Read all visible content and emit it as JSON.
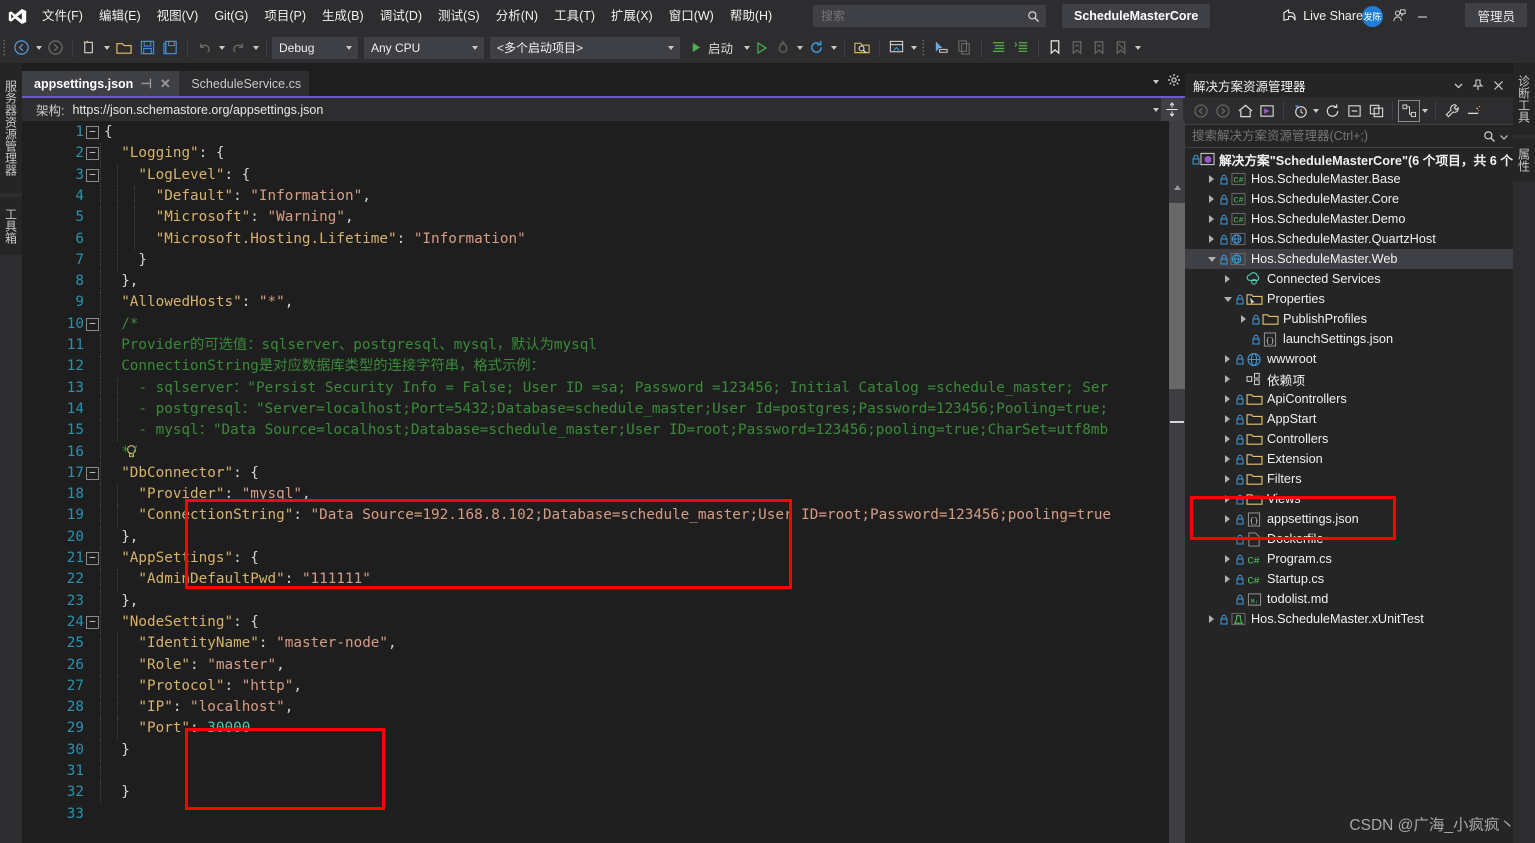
{
  "titlebar": {
    "menus": [
      "文件(F)",
      "编辑(E)",
      "视图(V)",
      "Git(G)",
      "项目(P)",
      "生成(B)",
      "调试(D)",
      "测试(S)",
      "分析(N)",
      "工具(T)",
      "扩展(X)",
      "窗口(W)",
      "帮助(H)"
    ],
    "search_placeholder": "搜索",
    "solution_name": "ScheduleMasterCore",
    "avatar_text": "发陈",
    "window_minimize": "—",
    "window_maximize": "▢",
    "window_close": "✕"
  },
  "toolbar": {
    "configuration": "Debug",
    "platform": "Any CPU",
    "startup_project": "<多个启动项目>",
    "start_label": "启动",
    "live_share_label": "Live Share",
    "admin_label": "管理员"
  },
  "left_rail": {
    "tabs": [
      "服务器资源管理器",
      "工具箱"
    ]
  },
  "right_rail": {
    "tabs": [
      "诊断工具",
      "属性"
    ]
  },
  "editor": {
    "tabs": [
      {
        "label": "appsettings.json",
        "active": true
      },
      {
        "label": "ScheduleService.cs",
        "active": false
      }
    ],
    "schema_label": "架构:",
    "schema_url": "https://json.schemastore.org/appsettings.json",
    "lines": [
      {
        "n": 1,
        "tokens": [
          {
            "t": "{",
            "c": "p"
          }
        ],
        "indent": 0,
        "fold": "minus"
      },
      {
        "n": 2,
        "tokens": [
          {
            "t": "\"Logging\"",
            "c": "k"
          },
          {
            "t": ": {",
            "c": "p"
          }
        ],
        "indent": 1,
        "fold": "minus"
      },
      {
        "n": 3,
        "tokens": [
          {
            "t": "\"LogLevel\"",
            "c": "k"
          },
          {
            "t": ": {",
            "c": "p"
          }
        ],
        "indent": 2,
        "fold": "minus"
      },
      {
        "n": 4,
        "tokens": [
          {
            "t": "\"Default\"",
            "c": "k"
          },
          {
            "t": ": ",
            "c": "p"
          },
          {
            "t": "\"Information\"",
            "c": "s"
          },
          {
            "t": ",",
            "c": "p"
          }
        ],
        "indent": 3
      },
      {
        "n": 5,
        "tokens": [
          {
            "t": "\"Microsoft\"",
            "c": "k"
          },
          {
            "t": ": ",
            "c": "p"
          },
          {
            "t": "\"Warning\"",
            "c": "s"
          },
          {
            "t": ",",
            "c": "p"
          }
        ],
        "indent": 3
      },
      {
        "n": 6,
        "tokens": [
          {
            "t": "\"Microsoft.Hosting.Lifetime\"",
            "c": "k"
          },
          {
            "t": ": ",
            "c": "p"
          },
          {
            "t": "\"Information\"",
            "c": "s"
          }
        ],
        "indent": 3
      },
      {
        "n": 7,
        "tokens": [
          {
            "t": "}",
            "c": "p"
          }
        ],
        "indent": 2
      },
      {
        "n": 8,
        "tokens": [
          {
            "t": "},",
            "c": "p"
          }
        ],
        "indent": 1
      },
      {
        "n": 9,
        "tokens": [
          {
            "t": "\"AllowedHosts\"",
            "c": "k"
          },
          {
            "t": ": ",
            "c": "p"
          },
          {
            "t": "\"*\"",
            "c": "s"
          },
          {
            "t": ",",
            "c": "p"
          }
        ],
        "indent": 1
      },
      {
        "n": 10,
        "tokens": [
          {
            "t": "/*",
            "c": "cmt"
          }
        ],
        "indent": 1,
        "fold": "minus"
      },
      {
        "n": 11,
        "tokens": [
          {
            "t": "Provider的可选值：sqlserver、postgresql、mysql，默认为mysql",
            "c": "cmt"
          }
        ],
        "indent": 1
      },
      {
        "n": 12,
        "tokens": [
          {
            "t": "ConnectionString是对应数据库类型的连接字符串，格式示例：",
            "c": "cmt"
          }
        ],
        "indent": 1
      },
      {
        "n": 13,
        "tokens": [
          {
            "t": "- sqlserver：\"Persist Security Info = False; User ID =sa; Password =123456; Initial Catalog =schedule_master; Ser",
            "c": "cmt"
          }
        ],
        "indent": 2
      },
      {
        "n": 14,
        "tokens": [
          {
            "t": "- postgresql：\"Server=localhost;Port=5432;Database=schedule_master;User Id=postgres;Password=123456;Pooling=true;",
            "c": "cmt"
          }
        ],
        "indent": 2
      },
      {
        "n": 15,
        "tokens": [
          {
            "t": "- mysql：\"Data Source=localhost;Database=schedule_master;User ID=root;Password=123456;pooling=true;CharSet=utf8mb",
            "c": "cmt"
          }
        ],
        "indent": 2
      },
      {
        "n": 16,
        "tokens": [
          {
            "t": "*/",
            "c": "cmt"
          }
        ],
        "indent": 1,
        "bulb": true
      },
      {
        "n": 17,
        "tokens": [
          {
            "t": "\"DbConnector\"",
            "c": "k"
          },
          {
            "t": ": {",
            "c": "p"
          }
        ],
        "indent": 1,
        "fold": "minus"
      },
      {
        "n": 18,
        "tokens": [
          {
            "t": "\"Provider\"",
            "c": "k"
          },
          {
            "t": ": ",
            "c": "p"
          },
          {
            "t": "\"mysql\"",
            "c": "s"
          },
          {
            "t": ",",
            "c": "p"
          }
        ],
        "indent": 2
      },
      {
        "n": 19,
        "tokens": [
          {
            "t": "\"ConnectionString\"",
            "c": "k"
          },
          {
            "t": ": ",
            "c": "p"
          },
          {
            "t": "\"Data Source=192.168.8.102;Database=schedule_master;User ID=root;Password=123456;pooling=true",
            "c": "s"
          }
        ],
        "indent": 2
      },
      {
        "n": 20,
        "tokens": [
          {
            "t": "},",
            "c": "p"
          }
        ],
        "indent": 1
      },
      {
        "n": 21,
        "tokens": [
          {
            "t": "\"AppSettings\"",
            "c": "k"
          },
          {
            "t": ": {",
            "c": "p"
          }
        ],
        "indent": 1,
        "fold": "minus"
      },
      {
        "n": 22,
        "tokens": [
          {
            "t": "\"AdminDefaultPwd\"",
            "c": "k"
          },
          {
            "t": ": ",
            "c": "p"
          },
          {
            "t": "\"111111\"",
            "c": "s"
          }
        ],
        "indent": 2
      },
      {
        "n": 23,
        "tokens": [
          {
            "t": "},",
            "c": "p"
          }
        ],
        "indent": 1
      },
      {
        "n": 24,
        "tokens": [
          {
            "t": "\"NodeSetting\"",
            "c": "k"
          },
          {
            "t": ": {",
            "c": "p"
          }
        ],
        "indent": 1,
        "fold": "minus"
      },
      {
        "n": 25,
        "tokens": [
          {
            "t": "\"IdentityName\"",
            "c": "k"
          },
          {
            "t": ": ",
            "c": "p"
          },
          {
            "t": "\"master-node\"",
            "c": "s"
          },
          {
            "t": ",",
            "c": "p"
          }
        ],
        "indent": 2
      },
      {
        "n": 26,
        "tokens": [
          {
            "t": "\"Role\"",
            "c": "k"
          },
          {
            "t": ": ",
            "c": "p"
          },
          {
            "t": "\"master\"",
            "c": "s"
          },
          {
            "t": ",",
            "c": "p"
          }
        ],
        "indent": 2
      },
      {
        "n": 27,
        "tokens": [
          {
            "t": "\"Protocol\"",
            "c": "k"
          },
          {
            "t": ": ",
            "c": "p"
          },
          {
            "t": "\"http\"",
            "c": "s"
          },
          {
            "t": ",",
            "c": "p"
          }
        ],
        "indent": 2
      },
      {
        "n": 28,
        "tokens": [
          {
            "t": "\"IP\"",
            "c": "k"
          },
          {
            "t": ": ",
            "c": "p"
          },
          {
            "t": "\"localhost\"",
            "c": "s"
          },
          {
            "t": ",",
            "c": "p"
          }
        ],
        "indent": 2
      },
      {
        "n": 29,
        "tokens": [
          {
            "t": "\"Port\"",
            "c": "k"
          },
          {
            "t": ": ",
            "c": "p"
          },
          {
            "t": "30000",
            "c": "num"
          }
        ],
        "indent": 2
      },
      {
        "n": 30,
        "tokens": [
          {
            "t": "}",
            "c": "p"
          }
        ],
        "indent": 1
      },
      {
        "n": 31,
        "tokens": [],
        "indent": 1
      },
      {
        "n": 32,
        "tokens": [
          {
            "t": "}",
            "c": "p"
          }
        ],
        "indent": 1
      },
      {
        "n": 33,
        "tokens": [],
        "indent": 0
      }
    ]
  },
  "solution_explorer": {
    "title": "解决方案资源管理器",
    "search_placeholder": "搜索解决方案资源管理器(Ctrl+;)",
    "tree": [
      {
        "depth": 0,
        "twisty": "none",
        "lock": true,
        "icon": "solution-icon",
        "label": "解决方案\"ScheduleMasterCore\"(6 个项目，共 6 个",
        "bold": true
      },
      {
        "depth": 1,
        "twisty": "closed",
        "lock": true,
        "icon": "csharp-icon",
        "label": "Hos.ScheduleMaster.Base"
      },
      {
        "depth": 1,
        "twisty": "closed",
        "lock": true,
        "icon": "csharp-icon",
        "label": "Hos.ScheduleMaster.Core"
      },
      {
        "depth": 1,
        "twisty": "closed",
        "lock": true,
        "icon": "csharp-icon",
        "label": "Hos.ScheduleMaster.Demo"
      },
      {
        "depth": 1,
        "twisty": "closed",
        "lock": true,
        "icon": "web-project-icon",
        "label": "Hos.ScheduleMaster.QuartzHost"
      },
      {
        "depth": 1,
        "twisty": "open",
        "lock": true,
        "icon": "web-project-icon",
        "label": "Hos.ScheduleMaster.Web",
        "selected": true
      },
      {
        "depth": 2,
        "twisty": "closed",
        "lock": false,
        "icon": "connected-services-icon",
        "label": "Connected Services"
      },
      {
        "depth": 2,
        "twisty": "open",
        "lock": true,
        "icon": "properties-folder-icon",
        "label": "Properties"
      },
      {
        "depth": 3,
        "twisty": "closed",
        "lock": true,
        "icon": "folder-icon",
        "label": "PublishProfiles"
      },
      {
        "depth": 3,
        "twisty": "none",
        "lock": true,
        "icon": "json-icon",
        "label": "launchSettings.json"
      },
      {
        "depth": 2,
        "twisty": "closed",
        "lock": true,
        "icon": "wwwroot-icon",
        "label": "wwwroot"
      },
      {
        "depth": 2,
        "twisty": "closed",
        "lock": false,
        "icon": "dependencies-icon",
        "label": "依赖项"
      },
      {
        "depth": 2,
        "twisty": "closed",
        "lock": true,
        "icon": "folder-icon",
        "label": "ApiControllers"
      },
      {
        "depth": 2,
        "twisty": "closed",
        "lock": true,
        "icon": "folder-icon",
        "label": "AppStart"
      },
      {
        "depth": 2,
        "twisty": "closed",
        "lock": true,
        "icon": "folder-icon",
        "label": "Controllers"
      },
      {
        "depth": 2,
        "twisty": "closed",
        "lock": true,
        "icon": "folder-icon",
        "label": "Extension"
      },
      {
        "depth": 2,
        "twisty": "closed",
        "lock": true,
        "icon": "folder-icon",
        "label": "Filters"
      },
      {
        "depth": 2,
        "twisty": "closed",
        "lock": true,
        "icon": "folder-icon",
        "label": "Views"
      },
      {
        "depth": 2,
        "twisty": "closed",
        "lock": true,
        "icon": "json-icon",
        "label": "appsettings.json"
      },
      {
        "depth": 2,
        "twisty": "none",
        "lock": true,
        "icon": "file-icon",
        "label": "Dockerfile"
      },
      {
        "depth": 2,
        "twisty": "closed",
        "lock": true,
        "icon": "csharp-file-icon",
        "label": "Program.cs"
      },
      {
        "depth": 2,
        "twisty": "closed",
        "lock": true,
        "icon": "csharp-file-icon",
        "label": "Startup.cs"
      },
      {
        "depth": 2,
        "twisty": "none",
        "lock": true,
        "icon": "markdown-icon",
        "label": "todolist.md"
      },
      {
        "depth": 1,
        "twisty": "closed",
        "lock": true,
        "icon": "test-project-icon",
        "label": "Hos.ScheduleMaster.xUnitTest"
      }
    ]
  },
  "watermark": "CSDN @广海_小疯疯丶",
  "colors": {
    "accent": "#6a5acd",
    "annotation_red": "#ff0000",
    "chrome": "#2d2d30",
    "editor_bg": "#1e1e1e",
    "panel_bg": "#252526",
    "json_key": "#d6b36c",
    "json_string": "#d69d85",
    "comment_green": "#3a8a3a",
    "number_teal": "#4ec9b0",
    "line_number": "#2b91af",
    "start_green": "#4caf50"
  }
}
